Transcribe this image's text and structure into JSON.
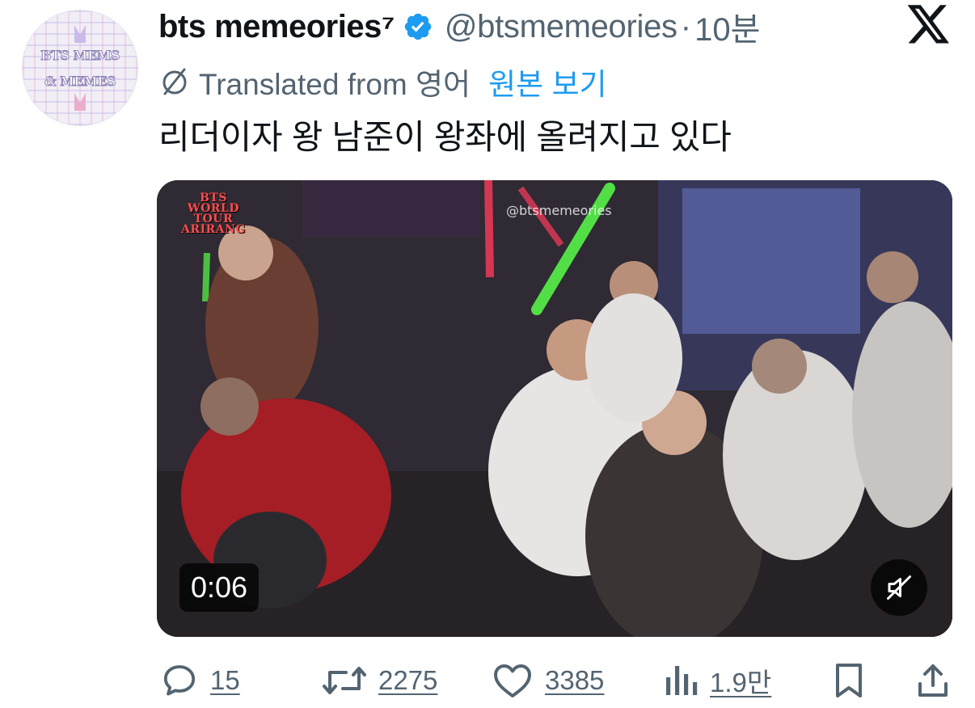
{
  "tweet": {
    "author_name": "bts memeories",
    "author_superscript": "⁷",
    "handle": "@btsmemeories",
    "separator": "·",
    "time": "10분",
    "translation_note": "Translated from 영어",
    "show_original": "원본 보기",
    "text": "리더이자 왕 남준이 왕좌에 올려지고 있다",
    "avatar_text": [
      "BTS MEMS",
      "& MEMES"
    ]
  },
  "media": {
    "duration": "0:06",
    "watermark": "@btsmemeories",
    "tour_logo": [
      "BTS",
      "WORLD TOUR",
      "ARIRANG"
    ],
    "muted": true
  },
  "actions": {
    "replies": "15",
    "reposts": "2275",
    "likes": "3385",
    "views": "1.9만"
  },
  "colors": {
    "text": "#0f1419",
    "secondary": "#536471",
    "link": "#1d9bf0",
    "verified": "#1d9bf0"
  },
  "icons": {
    "verified": "verified-badge-icon",
    "platform": "x-logo-icon",
    "translate": "globe-slash-icon",
    "reply": "reply-icon",
    "repost": "repost-icon",
    "like": "heart-icon",
    "views": "views-bar-icon",
    "bookmark": "bookmark-icon",
    "share": "share-icon",
    "mute": "muted-speaker-icon"
  }
}
